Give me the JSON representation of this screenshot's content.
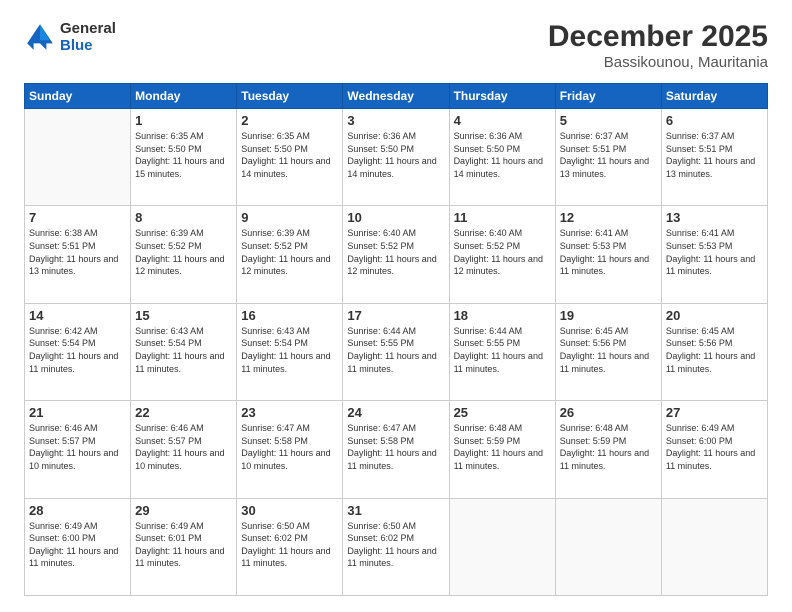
{
  "logo": {
    "line1": "General",
    "line2": "Blue"
  },
  "header": {
    "month": "December 2025",
    "location": "Bassikounou, Mauritania"
  },
  "weekdays": [
    "Sunday",
    "Monday",
    "Tuesday",
    "Wednesday",
    "Thursday",
    "Friday",
    "Saturday"
  ],
  "weeks": [
    [
      {
        "day": null
      },
      {
        "day": 1,
        "sunrise": "6:35 AM",
        "sunset": "5:50 PM",
        "daylight": "11 hours and 15 minutes."
      },
      {
        "day": 2,
        "sunrise": "6:35 AM",
        "sunset": "5:50 PM",
        "daylight": "11 hours and 14 minutes."
      },
      {
        "day": 3,
        "sunrise": "6:36 AM",
        "sunset": "5:50 PM",
        "daylight": "11 hours and 14 minutes."
      },
      {
        "day": 4,
        "sunrise": "6:36 AM",
        "sunset": "5:50 PM",
        "daylight": "11 hours and 14 minutes."
      },
      {
        "day": 5,
        "sunrise": "6:37 AM",
        "sunset": "5:51 PM",
        "daylight": "11 hours and 13 minutes."
      },
      {
        "day": 6,
        "sunrise": "6:37 AM",
        "sunset": "5:51 PM",
        "daylight": "11 hours and 13 minutes."
      }
    ],
    [
      {
        "day": 7,
        "sunrise": "6:38 AM",
        "sunset": "5:51 PM",
        "daylight": "11 hours and 13 minutes."
      },
      {
        "day": 8,
        "sunrise": "6:39 AM",
        "sunset": "5:52 PM",
        "daylight": "11 hours and 12 minutes."
      },
      {
        "day": 9,
        "sunrise": "6:39 AM",
        "sunset": "5:52 PM",
        "daylight": "11 hours and 12 minutes."
      },
      {
        "day": 10,
        "sunrise": "6:40 AM",
        "sunset": "5:52 PM",
        "daylight": "11 hours and 12 minutes."
      },
      {
        "day": 11,
        "sunrise": "6:40 AM",
        "sunset": "5:52 PM",
        "daylight": "11 hours and 12 minutes."
      },
      {
        "day": 12,
        "sunrise": "6:41 AM",
        "sunset": "5:53 PM",
        "daylight": "11 hours and 11 minutes."
      },
      {
        "day": 13,
        "sunrise": "6:41 AM",
        "sunset": "5:53 PM",
        "daylight": "11 hours and 11 minutes."
      }
    ],
    [
      {
        "day": 14,
        "sunrise": "6:42 AM",
        "sunset": "5:54 PM",
        "daylight": "11 hours and 11 minutes."
      },
      {
        "day": 15,
        "sunrise": "6:43 AM",
        "sunset": "5:54 PM",
        "daylight": "11 hours and 11 minutes."
      },
      {
        "day": 16,
        "sunrise": "6:43 AM",
        "sunset": "5:54 PM",
        "daylight": "11 hours and 11 minutes."
      },
      {
        "day": 17,
        "sunrise": "6:44 AM",
        "sunset": "5:55 PM",
        "daylight": "11 hours and 11 minutes."
      },
      {
        "day": 18,
        "sunrise": "6:44 AM",
        "sunset": "5:55 PM",
        "daylight": "11 hours and 11 minutes."
      },
      {
        "day": 19,
        "sunrise": "6:45 AM",
        "sunset": "5:56 PM",
        "daylight": "11 hours and 11 minutes."
      },
      {
        "day": 20,
        "sunrise": "6:45 AM",
        "sunset": "5:56 PM",
        "daylight": "11 hours and 11 minutes."
      }
    ],
    [
      {
        "day": 21,
        "sunrise": "6:46 AM",
        "sunset": "5:57 PM",
        "daylight": "11 hours and 10 minutes."
      },
      {
        "day": 22,
        "sunrise": "6:46 AM",
        "sunset": "5:57 PM",
        "daylight": "11 hours and 10 minutes."
      },
      {
        "day": 23,
        "sunrise": "6:47 AM",
        "sunset": "5:58 PM",
        "daylight": "11 hours and 10 minutes."
      },
      {
        "day": 24,
        "sunrise": "6:47 AM",
        "sunset": "5:58 PM",
        "daylight": "11 hours and 11 minutes."
      },
      {
        "day": 25,
        "sunrise": "6:48 AM",
        "sunset": "5:59 PM",
        "daylight": "11 hours and 11 minutes."
      },
      {
        "day": 26,
        "sunrise": "6:48 AM",
        "sunset": "5:59 PM",
        "daylight": "11 hours and 11 minutes."
      },
      {
        "day": 27,
        "sunrise": "6:49 AM",
        "sunset": "6:00 PM",
        "daylight": "11 hours and 11 minutes."
      }
    ],
    [
      {
        "day": 28,
        "sunrise": "6:49 AM",
        "sunset": "6:00 PM",
        "daylight": "11 hours and 11 minutes."
      },
      {
        "day": 29,
        "sunrise": "6:49 AM",
        "sunset": "6:01 PM",
        "daylight": "11 hours and 11 minutes."
      },
      {
        "day": 30,
        "sunrise": "6:50 AM",
        "sunset": "6:02 PM",
        "daylight": "11 hours and 11 minutes."
      },
      {
        "day": 31,
        "sunrise": "6:50 AM",
        "sunset": "6:02 PM",
        "daylight": "11 hours and 11 minutes."
      },
      {
        "day": null
      },
      {
        "day": null
      },
      {
        "day": null
      }
    ]
  ],
  "labels": {
    "sunrise": "Sunrise:",
    "sunset": "Sunset:",
    "daylight": "Daylight:"
  }
}
